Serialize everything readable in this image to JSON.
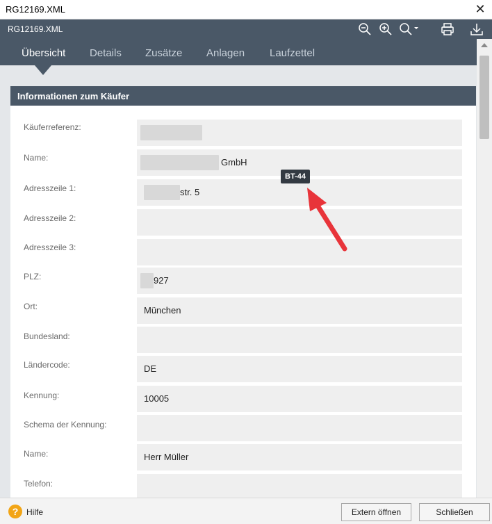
{
  "window": {
    "title": "RG12169.XML"
  },
  "toolbar": {
    "document_name": "RG12169.XML",
    "icons": [
      "zoom-out-icon",
      "zoom-in-icon",
      "zoom-menu-icon",
      "print-icon",
      "download-icon"
    ]
  },
  "tabs": [
    {
      "label": "Übersicht",
      "active": true
    },
    {
      "label": "Details",
      "active": false
    },
    {
      "label": "Zusätze",
      "active": false
    },
    {
      "label": "Anlagen",
      "active": false
    },
    {
      "label": "Laufzettel",
      "active": false
    }
  ],
  "section": {
    "title": "Informationen zum Käufer"
  },
  "fields": [
    {
      "label": "Käuferreferenz:",
      "value": ""
    },
    {
      "label": "Name:",
      "value": "GmbH"
    },
    {
      "label": "Adresszeile 1:",
      "value": "str. 5"
    },
    {
      "label": "Adresszeile 2:",
      "value": ""
    },
    {
      "label": "Adresszeile 3:",
      "value": ""
    },
    {
      "label": "PLZ:",
      "value": "927"
    },
    {
      "label": "Ort:",
      "value": "München"
    },
    {
      "label": "Bundesland:",
      "value": ""
    },
    {
      "label": "Ländercode:",
      "value": "DE"
    },
    {
      "label": "Kennung:",
      "value": "10005"
    },
    {
      "label": "Schema der Kennung:",
      "value": ""
    },
    {
      "label": "Name:",
      "value": "Herr Müller"
    },
    {
      "label": "Telefon:",
      "value": ""
    }
  ],
  "tooltip": {
    "text": "BT-44"
  },
  "footer": {
    "help_label": "Hilfe",
    "help_icon_glyph": "?",
    "extern_button": "Extern öffnen",
    "close_button": "Schließen"
  },
  "colors": {
    "header_bg": "#4a5867",
    "annotation_arrow": "#e8343a",
    "help_icon": "#f2a516"
  }
}
